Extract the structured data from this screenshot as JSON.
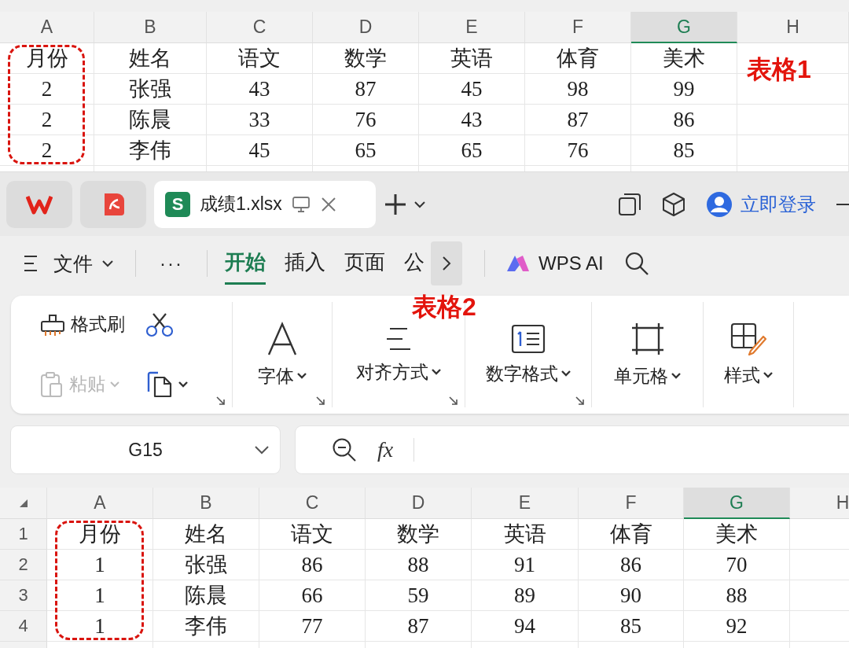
{
  "sheet_top": {
    "columns": [
      {
        "label": "A",
        "selected": false,
        "highlighted": true
      },
      {
        "label": "B",
        "selected": false,
        "highlighted": false
      },
      {
        "label": "C",
        "selected": false,
        "highlighted": false
      },
      {
        "label": "D",
        "selected": false,
        "highlighted": false
      },
      {
        "label": "E",
        "selected": false,
        "highlighted": false
      },
      {
        "label": "F",
        "selected": false,
        "highlighted": false
      },
      {
        "label": "G",
        "selected": true,
        "highlighted": false
      },
      {
        "label": "H",
        "selected": false,
        "highlighted": false
      }
    ],
    "rows": [
      {
        "cells": [
          "月份",
          "姓名",
          "语文",
          "数学",
          "英语",
          "体育",
          "美术"
        ]
      },
      {
        "cells": [
          "2",
          "张强",
          "43",
          "87",
          "45",
          "98",
          "99"
        ]
      },
      {
        "cells": [
          "2",
          "陈晨",
          "33",
          "76",
          "43",
          "87",
          "86"
        ]
      },
      {
        "cells": [
          "2",
          "李伟",
          "45",
          "65",
          "65",
          "76",
          "85"
        ]
      }
    ],
    "annotation": "表格1"
  },
  "app_tabs": [
    {
      "kind": "home",
      "selected": false
    },
    {
      "kind": "pdf",
      "selected": false
    },
    {
      "kind": "sheet",
      "icon_text": "S",
      "label": "成绩1.xlsx",
      "selected": true
    }
  ],
  "login": "立即登录",
  "menu": {
    "file": "文件",
    "more": "···",
    "tabs": [
      {
        "label": "开始",
        "selected": true
      },
      {
        "label": "插入",
        "selected": false
      },
      {
        "label": "页面",
        "selected": false
      },
      {
        "label": "公",
        "selected": false
      }
    ],
    "ai": "WPS AI"
  },
  "ribbon": {
    "annotation": "表格2",
    "format_painter": "格式刷",
    "paste": {
      "label": "粘贴",
      "disabled": true
    },
    "groups": [
      {
        "kind": "font",
        "label": "字体",
        "launcher": true
      },
      {
        "kind": "align",
        "label": "对齐方式",
        "launcher": true
      },
      {
        "kind": "number",
        "label": "数字格式",
        "launcher": true
      },
      {
        "kind": "cell",
        "label": "单元格",
        "launcher": false
      },
      {
        "kind": "style",
        "label": "样式",
        "launcher": false
      }
    ]
  },
  "formula_bar": {
    "name_box": "G15",
    "fx": "fx"
  },
  "sheet_bottom": {
    "columns": [
      {
        "label": "A",
        "selected": false,
        "highlighted": true
      },
      {
        "label": "B",
        "selected": false,
        "highlighted": false
      },
      {
        "label": "C",
        "selected": false,
        "highlighted": false
      },
      {
        "label": "D",
        "selected": false,
        "highlighted": false
      },
      {
        "label": "E",
        "selected": false,
        "highlighted": false
      },
      {
        "label": "F",
        "selected": false,
        "highlighted": false
      },
      {
        "label": "G",
        "selected": true,
        "highlighted": false
      },
      {
        "label": "H",
        "selected": false,
        "highlighted": false
      }
    ],
    "rows": [
      {
        "number": "1",
        "cells": [
          "月份",
          "姓名",
          "语文",
          "数学",
          "英语",
          "体育",
          "美术"
        ]
      },
      {
        "number": "2",
        "cells": [
          "1",
          "张强",
          "86",
          "88",
          "91",
          "86",
          "70"
        ]
      },
      {
        "number": "3",
        "cells": [
          "1",
          "陈晨",
          "66",
          "59",
          "89",
          "90",
          "88"
        ]
      },
      {
        "number": "4",
        "cells": [
          "1",
          "李伟",
          "77",
          "87",
          "94",
          "85",
          "92"
        ]
      }
    ]
  }
}
